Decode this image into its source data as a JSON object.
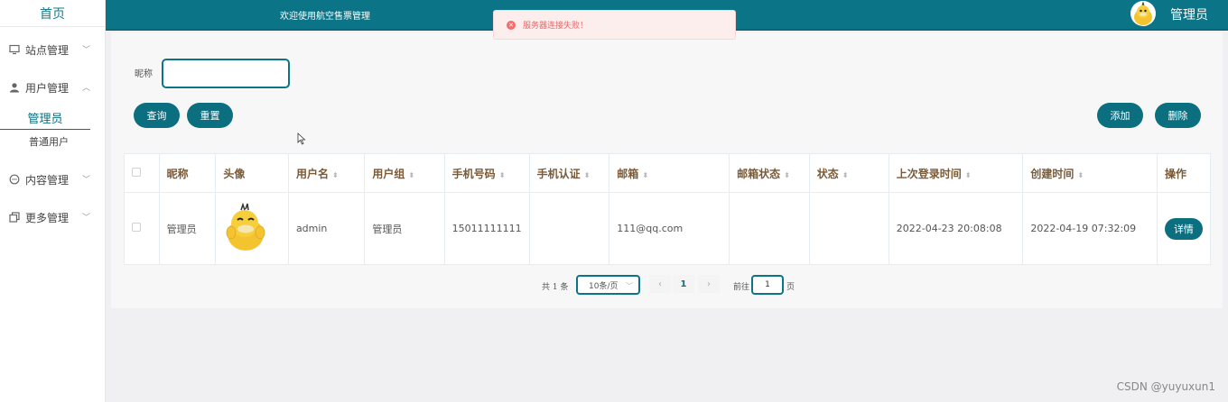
{
  "sidebar": {
    "home": "首页",
    "menus": [
      {
        "label": "站点管理",
        "icon": "monitor-icon"
      },
      {
        "label": "用户管理",
        "icon": "user-icon",
        "expanded": true,
        "children": [
          "管理员",
          "普通用户"
        ]
      },
      {
        "label": "内容管理",
        "icon": "chat-icon"
      },
      {
        "label": "更多管理",
        "icon": "copy-icon"
      }
    ]
  },
  "topbar": {
    "welcome": "欢迎使用航空售票管理",
    "admin_name": "管理员"
  },
  "toast": {
    "message": "服务器连接失败！",
    "type": "error"
  },
  "search": {
    "label": "昵称",
    "value": "",
    "query_btn": "查询",
    "reset_btn": "重置"
  },
  "actions": {
    "add": "添加",
    "delete": "删除"
  },
  "table": {
    "headers": [
      "昵称",
      "头像",
      "用户名",
      "用户组",
      "手机号码",
      "手机认证",
      "邮箱",
      "邮箱状态",
      "状态",
      "上次登录时间",
      "创建时间",
      "操作"
    ],
    "rows": [
      {
        "nickname": "管理员",
        "username": "admin",
        "group": "管理员",
        "phone": "15011111111",
        "phone_verify": "",
        "email": "111@qq.com",
        "email_status": "",
        "status": "",
        "last_login": "2022-04-23 20:08:08",
        "created": "2022-04-19 07:32:09",
        "action": "详情"
      }
    ]
  },
  "pagination": {
    "total": "共 1 条",
    "page_size": "10条/页",
    "current": "1",
    "goto_prefix": "前往",
    "goto_value": "1",
    "goto_suffix": "页"
  },
  "watermark": "CSDN @yuyuxun1",
  "colors": {
    "primary": "#0b7487",
    "header_text": "#7a5a37",
    "error": "#f56c6c"
  }
}
